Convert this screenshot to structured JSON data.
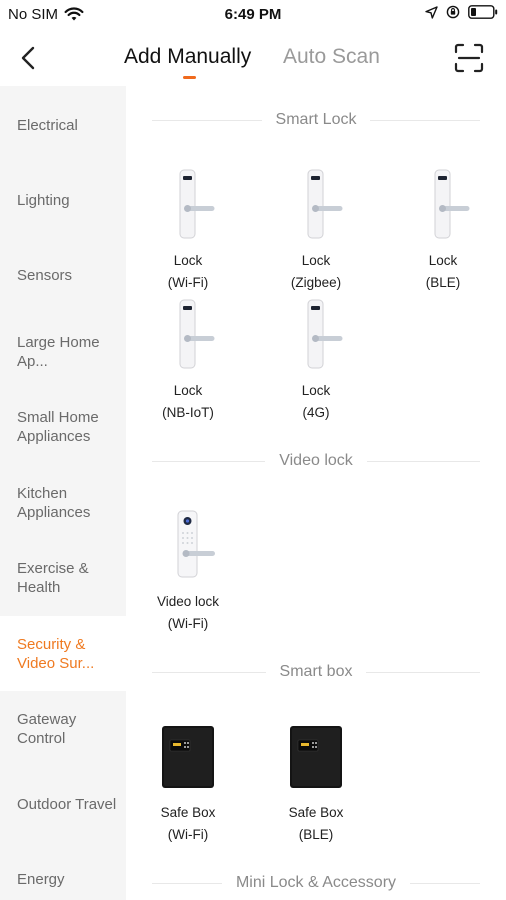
{
  "status_bar": {
    "carrier": "No SIM",
    "time": "6:49 PM"
  },
  "nav": {
    "tab_manual": "Add Manually",
    "tab_auto": "Auto Scan",
    "accent_color": "#f06a1d"
  },
  "sidebar": {
    "items": [
      {
        "label": "Electrical"
      },
      {
        "label": "Lighting"
      },
      {
        "label": "Sensors"
      },
      {
        "label": "Large Home Ap..."
      },
      {
        "label": "Small Home Appliances"
      },
      {
        "label": "Kitchen Appliances"
      },
      {
        "label": "Exercise & Health"
      },
      {
        "label": "Security & Video Sur..."
      },
      {
        "label": "Gateway Control"
      },
      {
        "label": "Outdoor Travel"
      },
      {
        "label": "Energy"
      }
    ],
    "active_index": 7
  },
  "sections": [
    {
      "title": "Smart Lock",
      "devices": [
        {
          "line1": "Lock",
          "line2": "(Wi-Fi)",
          "icon": "door-lock-icon"
        },
        {
          "line1": "Lock",
          "line2": "(Zigbee)",
          "icon": "door-lock-icon"
        },
        {
          "line1": "Lock",
          "line2": "(BLE)",
          "icon": "door-lock-icon"
        },
        {
          "line1": "Lock",
          "line2": "(NB-IoT)",
          "icon": "door-lock-icon"
        },
        {
          "line1": "Lock",
          "line2": "(4G)",
          "icon": "door-lock-icon"
        }
      ]
    },
    {
      "title": "Video lock",
      "devices": [
        {
          "line1": "Video lock",
          "line2": "(Wi-Fi)",
          "icon": "video-lock-icon"
        }
      ]
    },
    {
      "title": "Smart box",
      "devices": [
        {
          "line1": "Safe Box",
          "line2": "(Wi-Fi)",
          "icon": "safe-box-icon"
        },
        {
          "line1": "Safe Box",
          "line2": "(BLE)",
          "icon": "safe-box-icon"
        }
      ]
    },
    {
      "title": "Mini Lock & Accessory",
      "devices": []
    }
  ]
}
